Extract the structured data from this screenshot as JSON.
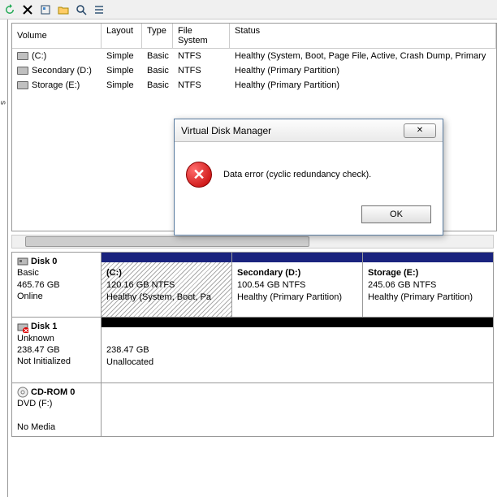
{
  "toolbar_icons": [
    "refresh",
    "props",
    "folder",
    "search",
    "settings"
  ],
  "leftlabel": "s",
  "columns": {
    "volume": "Volume",
    "layout": "Layout",
    "type": "Type",
    "fs": "File System",
    "status": "Status"
  },
  "volumes": [
    {
      "name": "(C:)",
      "layout": "Simple",
      "type": "Basic",
      "fs": "NTFS",
      "status": "Healthy (System, Boot, Page File, Active, Crash Dump, Primary"
    },
    {
      "name": "Secondary (D:)",
      "layout": "Simple",
      "type": "Basic",
      "fs": "NTFS",
      "status": "Healthy (Primary Partition)"
    },
    {
      "name": "Storage (E:)",
      "layout": "Simple",
      "type": "Basic",
      "fs": "NTFS",
      "status": "Healthy (Primary Partition)"
    }
  ],
  "disks": [
    {
      "name": "Disk 0",
      "kind": "Basic",
      "size": "465.76 GB",
      "state": "Online",
      "parts": [
        {
          "label": "(C:)",
          "size": "120.16 GB NTFS",
          "status": "Healthy (System, Boot, Pa",
          "style": "hatched"
        },
        {
          "label": "Secondary  (D:)",
          "size": "100.54 GB NTFS",
          "status": "Healthy (Primary Partition)",
          "style": ""
        },
        {
          "label": "Storage  (E:)",
          "size": "245.06 GB NTFS",
          "status": "Healthy (Primary Partition)",
          "style": ""
        }
      ]
    },
    {
      "name": "Disk 1",
      "kind": "Unknown",
      "size": "238.47 GB",
      "state": "Not Initialized",
      "parts": [
        {
          "label": "",
          "size": "238.47 GB",
          "status": "Unallocated",
          "style": "unalloc"
        }
      ]
    },
    {
      "name": "CD-ROM 0",
      "kind": "DVD (F:)",
      "size": "",
      "state": "No Media",
      "parts": []
    }
  ],
  "dialog": {
    "title": "Virtual Disk Manager",
    "message": "Data error (cyclic redundancy check).",
    "ok": "OK",
    "close_glyph": "✕"
  }
}
